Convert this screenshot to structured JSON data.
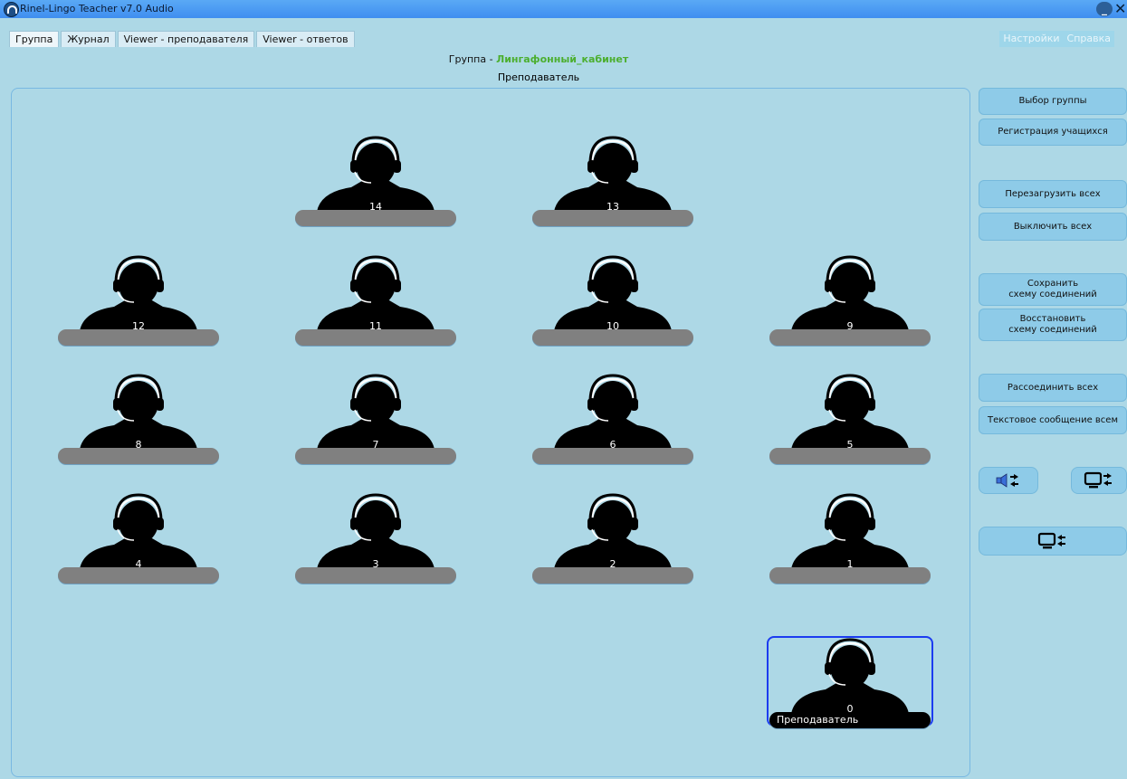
{
  "window": {
    "title": "Rinel-Lingo Teacher v7.0 Audio"
  },
  "tabs": [
    {
      "label": "Группа"
    },
    {
      "label": "Журнал"
    },
    {
      "label": "Viewer - преподавателя"
    },
    {
      "label": "Viewer - ответов"
    }
  ],
  "top_menu": {
    "settings": "Настройки",
    "help": "Справка"
  },
  "header": {
    "group_prefix": "Группа - ",
    "group_name": "Лингафонный_кабинет",
    "role": "Преподаватель"
  },
  "students": [
    {
      "number": "14",
      "name": ""
    },
    {
      "number": "13",
      "name": ""
    },
    {
      "number": "12",
      "name": ""
    },
    {
      "number": "11",
      "name": ""
    },
    {
      "number": "10",
      "name": ""
    },
    {
      "number": "9",
      "name": ""
    },
    {
      "number": "8",
      "name": ""
    },
    {
      "number": "7",
      "name": ""
    },
    {
      "number": "6",
      "name": ""
    },
    {
      "number": "5",
      "name": ""
    },
    {
      "number": "4",
      "name": ""
    },
    {
      "number": "3",
      "name": ""
    },
    {
      "number": "2",
      "name": ""
    },
    {
      "number": "1",
      "name": ""
    }
  ],
  "teacher": {
    "number": "0",
    "name": "Преподаватель"
  },
  "sidebar": {
    "select_group": "Выбор группы",
    "register_students": "Регистрация учащихся",
    "reboot_all": "Перезагрузить всех",
    "shutdown_all": "Выключить всех",
    "save_scheme": "Сохранить\nсхему соединений",
    "restore_scheme": "Восстановить\nсхему соединений",
    "disconnect_all": "Рассоединить всех",
    "text_message_all": "Текстовое сообщение всем"
  },
  "colors": {
    "background": "#add8e6",
    "titlebar": "#4a9df4",
    "group_name": "#4caf2f",
    "namebar_empty": "#808080",
    "teacher_border": "#1c3cf0"
  },
  "icons": [
    "app-headphones-icon",
    "minimize-icon",
    "close-icon",
    "headset-person-icon",
    "speaker-transfer-icon",
    "monitor-transfer-icon",
    "monitor-receive-icon"
  ]
}
